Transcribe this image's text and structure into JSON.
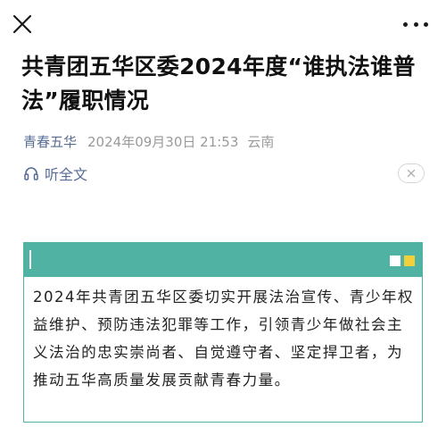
{
  "header": {
    "close_icon": "close-icon",
    "more_icon": "more-dots-icon"
  },
  "article": {
    "title": "共青团五华区委2024年度“谁执法谁普法”履职情况",
    "account": "青春五华",
    "datetime": "2024年09月30日 21:53",
    "location": "云南",
    "listen_label": "听全文",
    "listen_icon": "headphones-icon",
    "listen_close_icon": "close-small-icon"
  },
  "card": {
    "text": "2024年共青团五华区委切实开展法治宣传、青少年权益维护、预防违法犯罪等工作，引领青少年做社会主义法治的忠实崇尚者、自觉遵守者、坚定捍卫者，为推动五华高质量发展贡献青春力量。",
    "colors": {
      "accent": "#4fb2a2",
      "square_white": "#ffffff",
      "square_yellow": "#f2d03c"
    }
  },
  "colors": {
    "link": "#576b95",
    "meta_gray": "#9a9a9a",
    "title": "#111111"
  }
}
